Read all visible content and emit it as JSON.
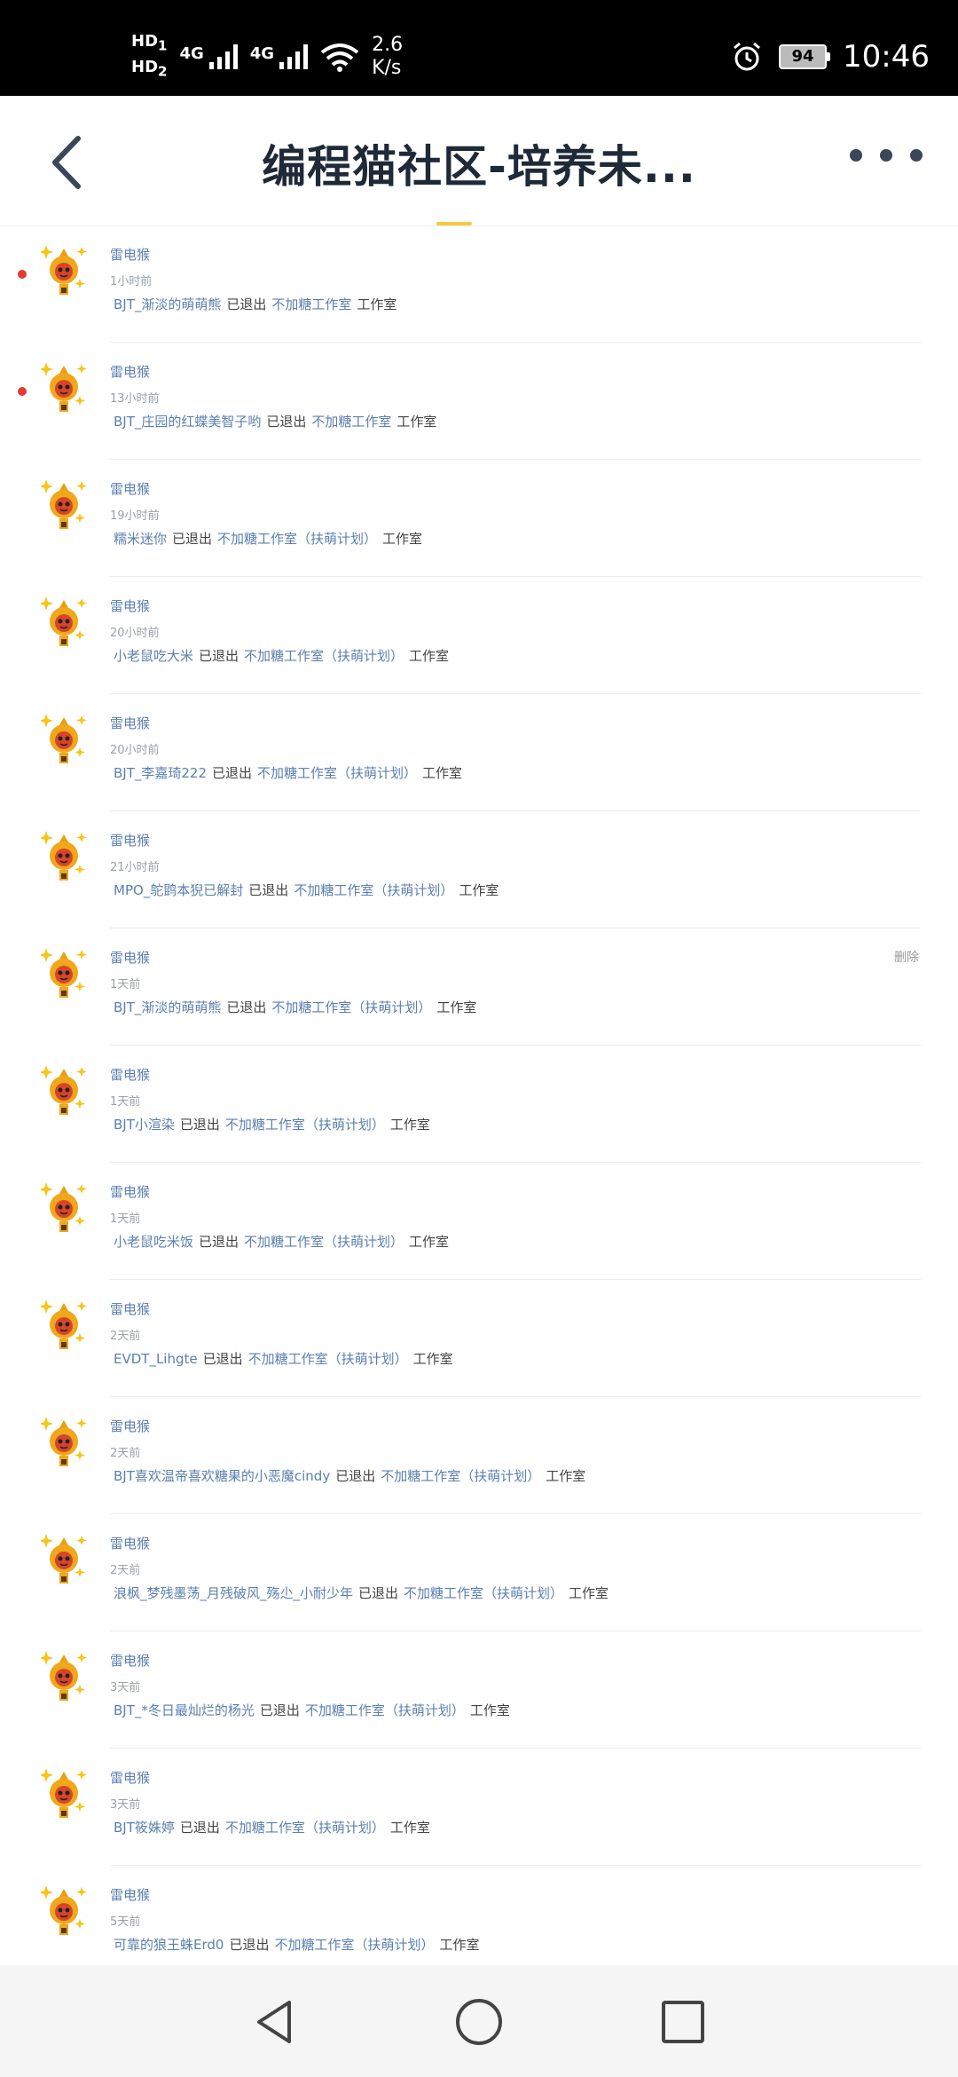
{
  "status_bar": {
    "hd1": "HD",
    "hd1_sub": "1",
    "hd2": "HD",
    "hd2_sub": "2",
    "net1": "4G",
    "net2": "4G",
    "speed_value": "2.6",
    "speed_unit": "K/s",
    "battery": "94",
    "time": "10:46"
  },
  "header": {
    "title": "编程猫社区-培养未...",
    "back_icon": "chevron-left-icon",
    "more_icon": "more-icon"
  },
  "items": [
    {
      "name": "雷电猴",
      "time": "1小时前",
      "user": "BJT_渐淡的萌萌熊",
      "action": "已退出",
      "studio": "不加糖工作室",
      "suffix": "工作室",
      "unread": true,
      "delete": ""
    },
    {
      "name": "雷电猴",
      "time": "13小时前",
      "user": "BJT_庄园的红蝶美智子哟",
      "action": "已退出",
      "studio": "不加糖工作室",
      "suffix": "工作室",
      "unread": true,
      "delete": ""
    },
    {
      "name": "雷电猴",
      "time": "19小时前",
      "user": "糯米迷你",
      "action": "已退出",
      "studio": "不加糖工作室（扶萌计划）",
      "suffix": "工作室",
      "unread": false,
      "delete": ""
    },
    {
      "name": "雷电猴",
      "time": "20小时前",
      "user": "小老鼠吃大米",
      "action": "已退出",
      "studio": "不加糖工作室（扶萌计划）",
      "suffix": "工作室",
      "unread": false,
      "delete": ""
    },
    {
      "name": "雷电猴",
      "time": "20小时前",
      "user": "BJT_李嘉琦222",
      "action": "已退出",
      "studio": "不加糖工作室（扶萌计划）",
      "suffix": "工作室",
      "unread": false,
      "delete": ""
    },
    {
      "name": "雷电猴",
      "time": "21小时前",
      "user": "MPO_鸵鹍本猊已解封",
      "action": "已退出",
      "studio": "不加糖工作室（扶萌计划）",
      "suffix": "工作室",
      "unread": false,
      "delete": ""
    },
    {
      "name": "雷电猴",
      "time": "1天前",
      "user": "BJT_渐淡的萌萌熊",
      "action": "已退出",
      "studio": "不加糖工作室（扶萌计划）",
      "suffix": "工作室",
      "unread": false,
      "delete": "删除"
    },
    {
      "name": "雷电猴",
      "time": "1天前",
      "user": "BJT小渲染",
      "action": "已退出",
      "studio": "不加糖工作室（扶萌计划）",
      "suffix": "工作室",
      "unread": false,
      "delete": ""
    },
    {
      "name": "雷电猴",
      "time": "1天前",
      "user": "小老鼠吃米饭",
      "action": "已退出",
      "studio": "不加糖工作室（扶萌计划）",
      "suffix": "工作室",
      "unread": false,
      "delete": ""
    },
    {
      "name": "雷电猴",
      "time": "2天前",
      "user": "EVDT_Lihgte",
      "action": "已退出",
      "studio": "不加糖工作室（扶萌计划）",
      "suffix": "工作室",
      "unread": false,
      "delete": ""
    },
    {
      "name": "雷电猴",
      "time": "2天前",
      "user": "BJT喜欢温帝喜欢糖果的小恶魔cindy",
      "action": "已退出",
      "studio": "不加糖工作室（扶萌计划）",
      "suffix": "工作室",
      "unread": false,
      "delete": ""
    },
    {
      "name": "雷电猴",
      "time": "2天前",
      "user": "浪枫_梦残墨荡_月残破风_殇尐_小耐少年",
      "action": "已退出",
      "studio": "不加糖工作室（扶萌计划）",
      "suffix": "工作室",
      "unread": false,
      "delete": ""
    },
    {
      "name": "雷电猴",
      "time": "3天前",
      "user": "BJT_*冬日最灿烂的杨光",
      "action": "已退出",
      "studio": "不加糖工作室（扶萌计划）",
      "suffix": "工作室",
      "unread": false,
      "delete": ""
    },
    {
      "name": "雷电猴",
      "time": "3天前",
      "user": "BJT筱姝婷",
      "action": "已退出",
      "studio": "不加糖工作室（扶萌计划）",
      "suffix": "工作室",
      "unread": false,
      "delete": ""
    },
    {
      "name": "雷电猴",
      "time": "5天前",
      "user": "可靠的狼王蛛Erd0",
      "action": "已退出",
      "studio": "不加糖工作室（扶萌计划）",
      "suffix": "工作室",
      "unread": false,
      "delete": ""
    }
  ],
  "nav": {
    "back_icon": "triangle-back-icon",
    "home_icon": "circle-home-icon",
    "recents_icon": "square-recents-icon"
  }
}
